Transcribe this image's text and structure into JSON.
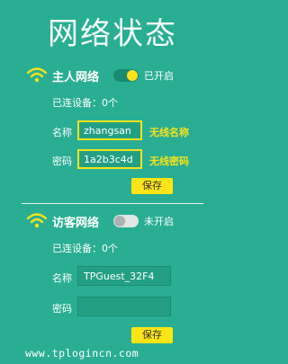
{
  "page_title": "网络状态",
  "main_network": {
    "name": "主人网络",
    "toggle_label": "已开启",
    "toggle_on": true,
    "devices_text": "已连设备：0个",
    "ssid_label": "名称",
    "ssid_value": "zhangsan",
    "ssid_annotation": "无线名称",
    "password_label": "密码",
    "password_value": "1a2b3c4d",
    "password_annotation": "无线密码",
    "save_label": "保存"
  },
  "guest_network": {
    "name": "访客网络",
    "toggle_label": "未开启",
    "toggle_on": false,
    "devices_text": "已连设备：0个",
    "ssid_label": "名称",
    "ssid_value": "TPGuest_32F4",
    "password_label": "密码",
    "password_value": "",
    "save_label": "保存"
  },
  "watermark": "www.tplogincn.com",
  "colors": {
    "background": "#2aae93",
    "accent_yellow": "#ffe515",
    "annotation_yellow": "#f7e21b"
  },
  "icons": [
    "wifi-icon"
  ]
}
